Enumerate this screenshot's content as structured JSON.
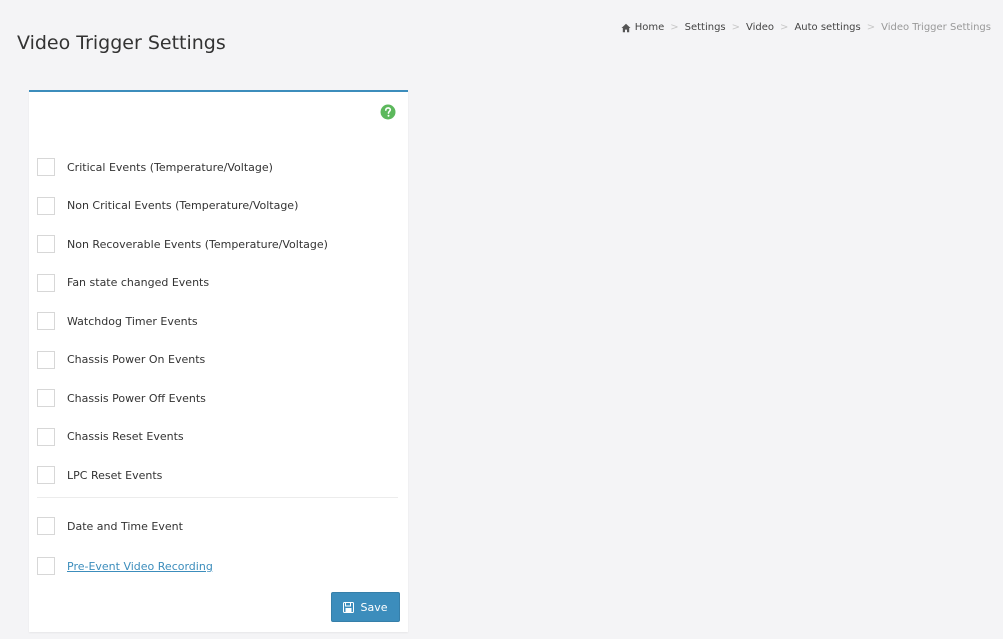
{
  "page_title": "Video Trigger Settings",
  "breadcrumb": [
    "Home",
    "Settings",
    "Video",
    "Auto settings",
    "Video Trigger Settings"
  ],
  "options": [
    "Critical Events (Temperature/Voltage)",
    "Non Critical Events (Temperature/Voltage)",
    "Non Recoverable Events (Temperature/Voltage)",
    "Fan state changed Events",
    "Watchdog Timer Events",
    "Chassis Power On Events",
    "Chassis Power Off Events",
    "Chassis Reset Events",
    "LPC Reset Events"
  ],
  "date_time_event": "Date and Time Event",
  "pre_event_recording": "Pre-Event Video Recording",
  "save_label": "Save",
  "colors": {
    "accent": "#3c8dbc",
    "help": "#5cb85c"
  },
  "icons": {
    "home": "home-icon",
    "help": "help-icon",
    "save": "floppy-disk-icon"
  }
}
